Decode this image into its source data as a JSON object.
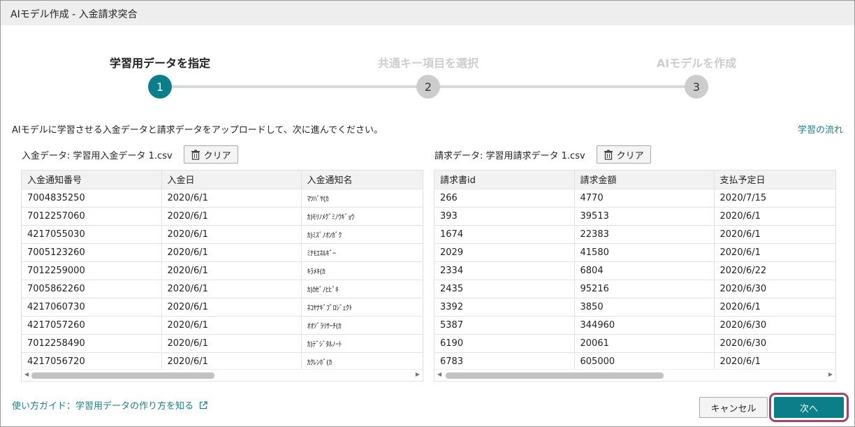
{
  "window": {
    "title": "AIモデル作成 - 入金請求突合"
  },
  "stepper": {
    "steps": [
      {
        "label": "学習用データを指定",
        "number": "1",
        "state": "active"
      },
      {
        "label": "共通キー項目を選択",
        "number": "2",
        "state": "inactive"
      },
      {
        "label": "AIモデルを作成",
        "number": "3",
        "state": "inactive"
      }
    ]
  },
  "instruction": "AIモデルに学習させる入金データと請求データをアップロードして、次に進んでください。",
  "flow_link": "学習の流れ",
  "deposit": {
    "label": "入金データ: 学習用入金データ 1.csv",
    "clear_label": "クリア",
    "columns": [
      "入金通知番号",
      "入金日",
      "入金通知名"
    ],
    "rows": [
      [
        "7004835250",
        "2020/6/1",
        "ﾏﾂﾊﾞﾔ(ｶ"
      ],
      [
        "7012257060",
        "2020/6/1",
        "ｶ)ﾓﾘﾉﾒｸﾞﾐﾉｳｷﾞｮｳ"
      ],
      [
        "4217055030",
        "2020/6/1",
        "ｶ)ﾐｽﾞﾉｵﾝｶﾞｸ"
      ],
      [
        "7005123260",
        "2020/6/1",
        "ﾐﾅﾓｴﾈﾙｷﾞｰ"
      ],
      [
        "7012259000",
        "2020/6/1",
        "ｷﾗﾒｷ(ｶ"
      ],
      [
        "7005862260",
        "2020/6/1",
        "ｶ)ｶｾﾞﾉﾋﾋﾞｷ"
      ],
      [
        "4217060730",
        "2020/6/1",
        "ﾈｺﾔﾅｷﾞﾌﾟﾛｼﾞｪｸﾄ"
      ],
      [
        "4217057260",
        "2020/6/1",
        "ｵｵｿﾞﾗﾘｻｰﾁ(ｶ"
      ],
      [
        "7012258490",
        "2020/6/1",
        "ｶ)ﾃﾞｼﾞﾀﾙﾉｰﾄ"
      ],
      [
        "4217056720",
        "2020/6/1",
        "ｶｸﾚﾝﾎﾞ(ｶ"
      ]
    ]
  },
  "invoice": {
    "label": "請求データ: 学習用請求データ 1.csv",
    "clear_label": "クリア",
    "columns": [
      "請求書id",
      "請求金額",
      "支払予定日"
    ],
    "rows": [
      [
        "266",
        "4770",
        "2020/7/15"
      ],
      [
        "393",
        "39513",
        "2020/6/1"
      ],
      [
        "1674",
        "22383",
        "2020/6/1"
      ],
      [
        "2029",
        "41580",
        "2020/6/1"
      ],
      [
        "2334",
        "6804",
        "2020/6/22"
      ],
      [
        "2435",
        "95216",
        "2020/6/30"
      ],
      [
        "3392",
        "3850",
        "2020/6/1"
      ],
      [
        "5387",
        "344960",
        "2020/6/30"
      ],
      [
        "6190",
        "20061",
        "2020/6/30"
      ],
      [
        "6783",
        "605000",
        "2020/6/1"
      ]
    ]
  },
  "guide_link": "使い方ガイド：学習用データの作り方を知る",
  "buttons": {
    "cancel": "キャンセル",
    "next": "次へ"
  },
  "colors": {
    "accent": "#0b7f89",
    "highlight": "#a5436e",
    "link": "#1a7f89"
  }
}
